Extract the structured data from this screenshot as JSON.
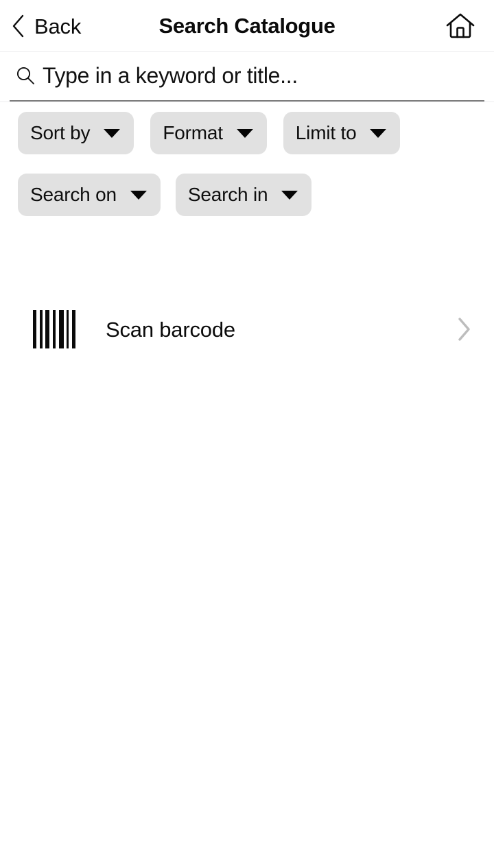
{
  "header": {
    "back_label": "Back",
    "back_icon": "chevron-left-icon",
    "title": "Search Catalogue",
    "home_icon": "home-icon"
  },
  "search": {
    "icon": "search-icon",
    "value": "",
    "placeholder": "Type in a keyword or title..."
  },
  "filters": {
    "row_1": [
      {
        "label": "Sort by",
        "icon": "chevron-down-icon"
      },
      {
        "label": "Format",
        "icon": "chevron-down-icon"
      },
      {
        "label": "Limit to",
        "icon": "chevron-down-icon"
      }
    ],
    "row_2": [
      {
        "label": "Search on",
        "icon": "chevron-down-icon"
      },
      {
        "label": "Search in",
        "icon": "chevron-down-icon"
      }
    ]
  },
  "scan": {
    "icon": "barcode-icon",
    "label": "Scan barcode",
    "disclosure_icon": "chevron-right-icon"
  },
  "colors": {
    "background": "#ffffff",
    "text": "#0b0b0b",
    "chip_background": "#e1e1e1",
    "divider": "#ececed",
    "search_underline": "#7d7d7d",
    "disclosure": "#bdbdbd"
  }
}
